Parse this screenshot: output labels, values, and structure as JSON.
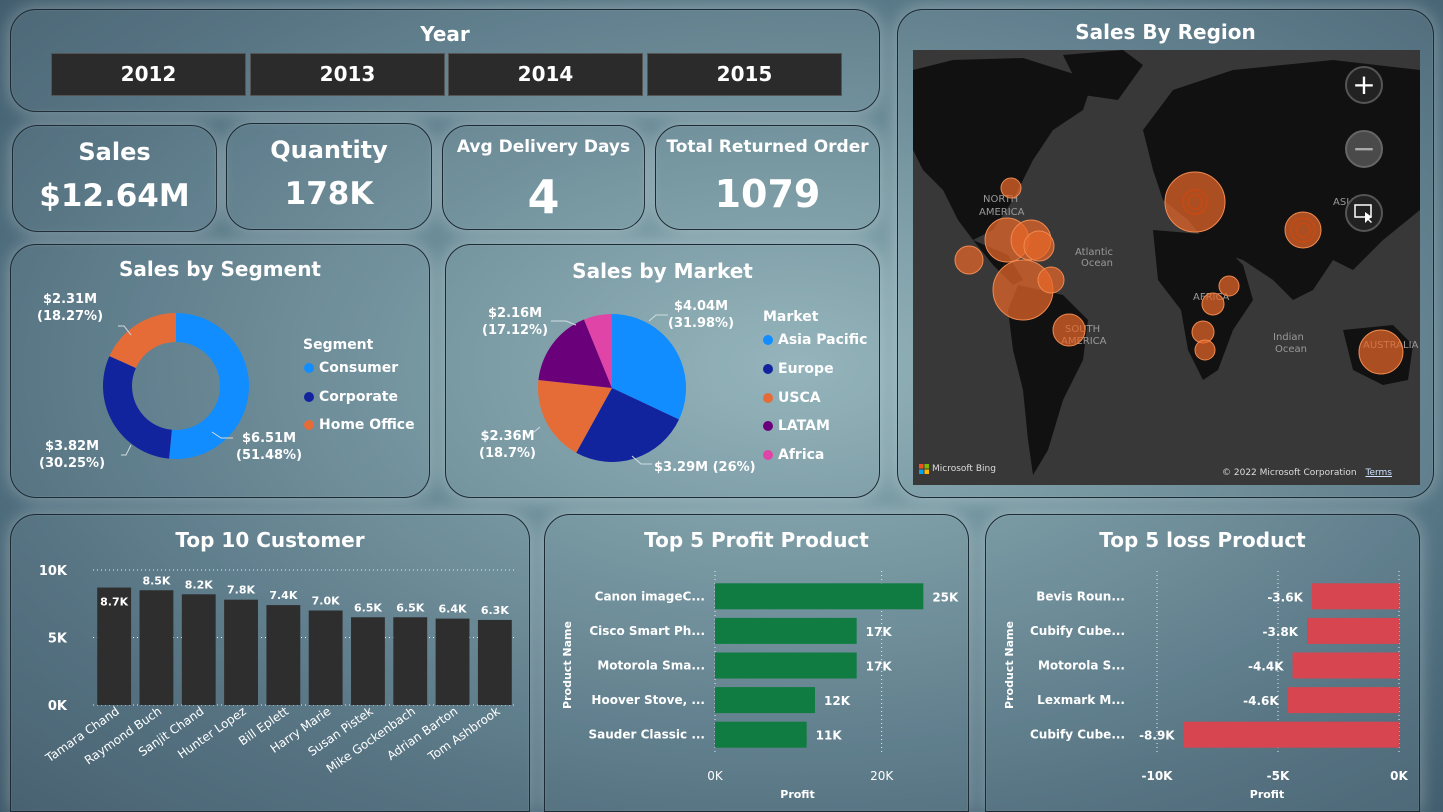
{
  "year_slicer": {
    "title": "Year",
    "years": [
      "2012",
      "2013",
      "2014",
      "2015"
    ]
  },
  "kpis": {
    "sales": {
      "label": "Sales",
      "value": "$12.64M"
    },
    "quantity": {
      "label": "Quantity",
      "value": "178K"
    },
    "avg_delivery": {
      "label": "Avg Delivery Days",
      "value": "4"
    },
    "returned": {
      "label": "Total Returned Order",
      "value": "1079"
    }
  },
  "segment": {
    "title": "Sales by Segment",
    "legend_title": "Segment",
    "labels": {
      "home": [
        "$2.31M",
        "(18.27%)"
      ],
      "corporate": [
        "$3.82M",
        "(30.25%)"
      ],
      "consumer": [
        "$6.51M",
        "(51.48%)"
      ]
    }
  },
  "market": {
    "title": "Sales by Market",
    "legend_title": "Market",
    "labels": {
      "asia": [
        "$4.04M",
        "(31.98%)"
      ],
      "europe": [
        "$3.29M (26%)"
      ],
      "usca": [
        "$2.36M",
        "(18.7%)"
      ],
      "latam": [
        "$2.16M",
        "(17.12%)"
      ]
    }
  },
  "region": {
    "title": "Sales By Region",
    "map_labels": [
      "NORTH",
      "AMERICA",
      "Atlantic",
      "Ocean",
      "SOUTH",
      "AMERICA",
      "AFRICA",
      "Indian",
      "Ocean",
      "AUSTRALIA",
      "ASIA"
    ],
    "bing": "Microsoft Bing",
    "copyright": "© 2022 Microsoft Corporation",
    "terms": "Terms",
    "bubble_color": "#e8662a"
  },
  "customers": {
    "title": "Top 10 Customer"
  },
  "profit": {
    "title": "Top 5 Profit Product",
    "ylabel": "Product Name",
    "xlabel": "Profit"
  },
  "loss": {
    "title": "Top 5 loss Product",
    "ylabel": "Product Name",
    "xlabel": "Profit"
  },
  "colors": {
    "consumer": "#118dff",
    "corporate": "#12239e",
    "home_office": "#e66c37",
    "asia_pacific": "#118dff",
    "europe": "#12239e",
    "usca": "#e66c37",
    "latam": "#6b007b",
    "africa": "#e044a7",
    "customer_bar": "#2e2e2e",
    "profit_bar": "#107c41",
    "loss_bar": "#d64550"
  },
  "chart_data": [
    {
      "type": "pie",
      "title": "Sales by Segment",
      "legend_title": "Segment",
      "categories": [
        "Consumer",
        "Corporate",
        "Home Office"
      ],
      "values": [
        6.51,
        3.82,
        2.31
      ],
      "percent": [
        51.48,
        30.25,
        18.27
      ]
    },
    {
      "type": "pie",
      "title": "Sales by Market",
      "legend_title": "Market",
      "categories": [
        "Asia Pacific",
        "Europe",
        "USCA",
        "LATAM",
        "Africa"
      ],
      "values": [
        4.04,
        3.29,
        2.36,
        2.16,
        0.78
      ],
      "percent": [
        31.98,
        26,
        18.7,
        17.12,
        6.2
      ]
    },
    {
      "type": "bar",
      "title": "Top 10 Customer",
      "categories": [
        "Tamara Chand",
        "Raymond Buch",
        "Sanjit Chand",
        "Hunter Lopez",
        "Bill Eplett",
        "Harry Marie",
        "Susan Pistek",
        "Mike Gockenbach",
        "Adrian Barton",
        "Tom Ashbrook"
      ],
      "values": [
        8700,
        8500,
        8200,
        7800,
        7400,
        7000,
        6500,
        6500,
        6400,
        6300
      ],
      "value_labels": [
        "8.7K",
        "8.5K",
        "8.2K",
        "7.8K",
        "7.4K",
        "7.0K",
        "6.5K",
        "6.5K",
        "6.4K",
        "6.3K"
      ],
      "yticks": [
        "0K",
        "5K",
        "10K"
      ],
      "ylim": [
        0,
        10000
      ]
    },
    {
      "type": "bar",
      "orientation": "horizontal",
      "title": "Top 5 Profit Product",
      "xlabel": "Profit",
      "ylabel": "Product Name",
      "categories": [
        "Canon imageC...",
        "Cisco Smart Ph...",
        "Motorola Sma...",
        "Hoover Stove, ...",
        "Sauder Classic ..."
      ],
      "values": [
        25000,
        17000,
        17000,
        12000,
        11000
      ],
      "value_labels": [
        "25K",
        "17K",
        "17K",
        "12K",
        "11K"
      ],
      "xticks": [
        "0K",
        "20K"
      ],
      "xlim": [
        0,
        27000
      ]
    },
    {
      "type": "bar",
      "orientation": "horizontal",
      "title": "Top 5 loss Product",
      "xlabel": "Profit",
      "ylabel": "Product Name",
      "categories": [
        "Bevis Roun...",
        "Cubify Cube...",
        "Motorola S...",
        "Lexmark M...",
        "Cubify Cube..."
      ],
      "values": [
        -3600,
        -3800,
        -4400,
        -4600,
        -8900
      ],
      "value_labels": [
        "-3.6K",
        "-3.8K",
        "-4.4K",
        "-4.6K",
        "-8.9K"
      ],
      "xticks": [
        "-10K",
        "-5K",
        "0K"
      ],
      "xlim": [
        -10000,
        0
      ]
    }
  ]
}
